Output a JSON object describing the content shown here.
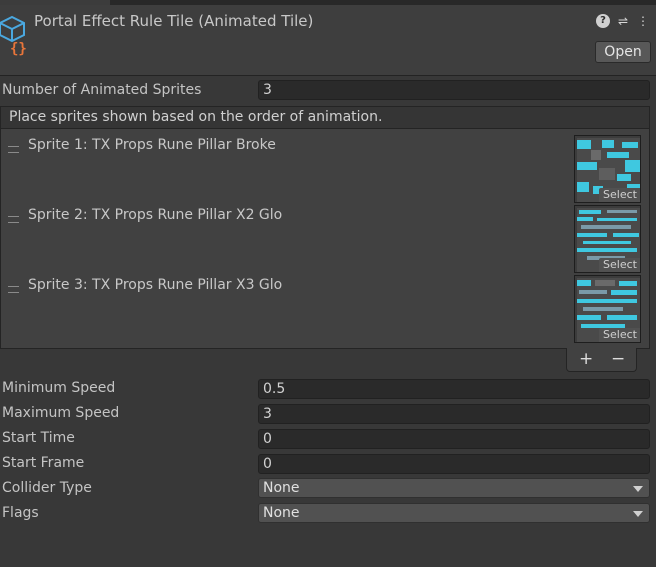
{
  "header": {
    "title": "Portal Effect Rule Tile (Animated Tile)",
    "open_label": "Open",
    "icons": [
      "help-icon",
      "preset-icon",
      "more-icon"
    ]
  },
  "fields": {
    "num_sprites_label": "Number of Animated Sprites",
    "num_sprites_value": "3",
    "list_header": "Place sprites shown based on the order of animation.",
    "sprites": [
      {
        "label": "Sprite 1: TX Props Rune Pillar Broke",
        "select": "Select"
      },
      {
        "label": "Sprite 2: TX Props Rune Pillar X2 Glo",
        "select": "Select"
      },
      {
        "label": "Sprite 3: TX Props Rune Pillar X3 Glo",
        "select": "Select"
      }
    ],
    "add_label": "+",
    "remove_label": "−",
    "min_speed_label": "Minimum Speed",
    "min_speed_value": "0.5",
    "max_speed_label": "Maximum Speed",
    "max_speed_value": "3",
    "start_time_label": "Start Time",
    "start_time_value": "0",
    "start_frame_label": "Start Frame",
    "start_frame_value": "0",
    "collider_label": "Collider Type",
    "collider_value": "None",
    "flags_label": "Flags",
    "flags_value": "None"
  },
  "colors": {
    "background": "#383838",
    "field_bg": "#2a2a2a",
    "sprite_cyan": "#3fc8e0",
    "icon_blue": "#4aa8e0",
    "icon_orange": "#e8753a"
  }
}
